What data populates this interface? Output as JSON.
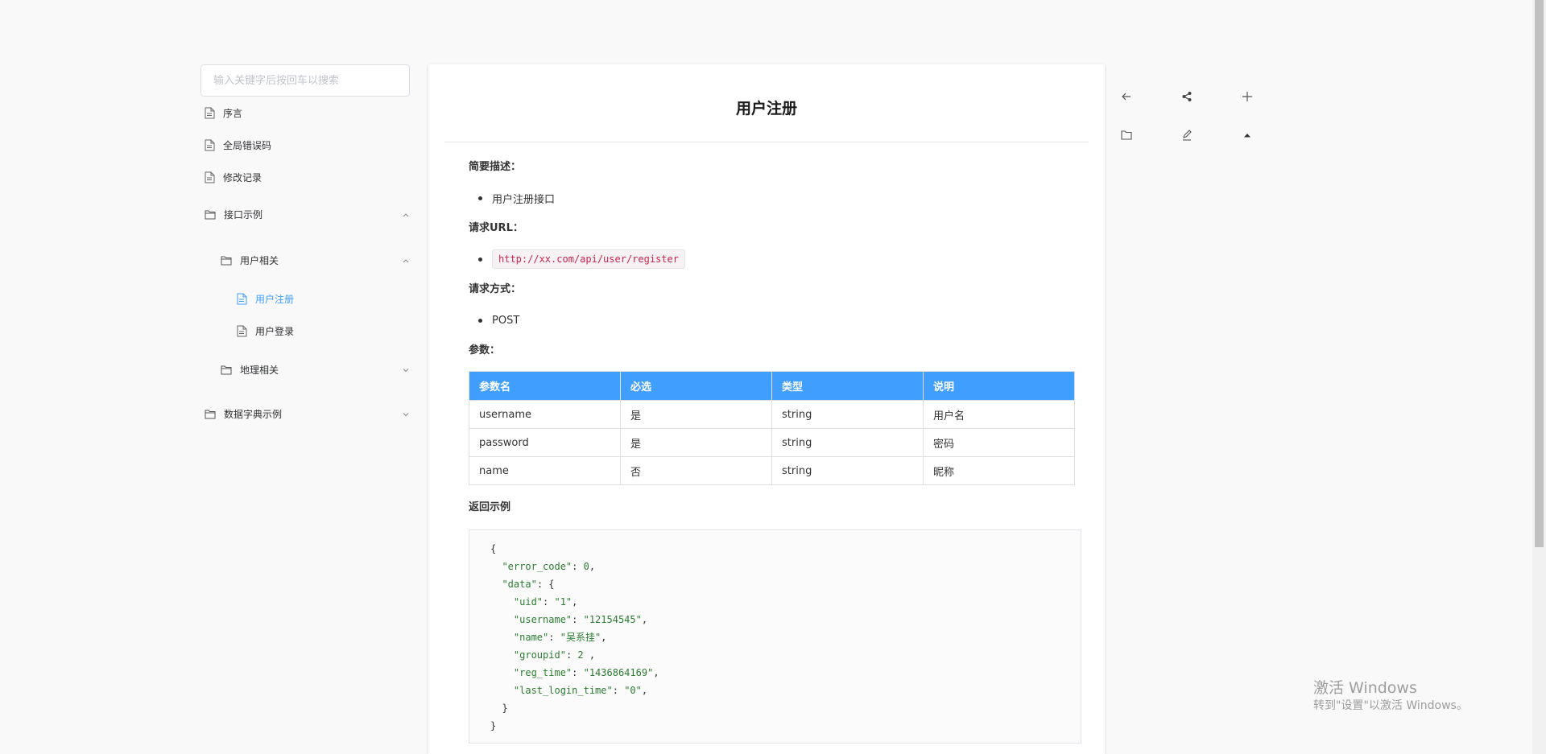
{
  "sidebar": {
    "search_placeholder": "输入关键字后按回车以搜索",
    "items": [
      {
        "label": "序言"
      },
      {
        "label": "全局错误码"
      },
      {
        "label": "修改记录"
      },
      {
        "label": "接口示例"
      },
      {
        "label": "用户相关"
      },
      {
        "label": "用户注册"
      },
      {
        "label": "用户登录"
      },
      {
        "label": "地理相关"
      },
      {
        "label": "数据字典示例"
      }
    ]
  },
  "doc": {
    "title": "用户注册",
    "desc_heading": "简要描述：",
    "desc_item": "用户注册接口",
    "url_heading": "请求URL：",
    "url_value": "http://xx.com/api/user/register",
    "method_heading": "请求方式：",
    "method_value": "POST",
    "params_heading": "参数：",
    "table": {
      "headers": [
        "参数名",
        "必选",
        "类型",
        "说明"
      ],
      "rows": [
        [
          "username",
          "是",
          "string",
          "用户名"
        ],
        [
          "password",
          "是",
          "string",
          "密码"
        ],
        [
          "name",
          "否",
          "string",
          "昵称"
        ]
      ]
    },
    "return_heading": "返回示例",
    "return_code": {
      "l1": "{",
      "l2k": "\"error_code\"",
      "l2v": "0",
      "l3k": "\"data\"",
      "l3v": "{",
      "l4k": "\"uid\"",
      "l4v": "\"1\"",
      "l5k": "\"username\"",
      "l5v": "\"12154545\"",
      "l6k": "\"name\"",
      "l6v": "\"吴系挂\"",
      "l7k": "\"groupid\"",
      "l7v": "2",
      "l8k": "\"reg_time\"",
      "l8v": "\"1436864169\"",
      "l9k": "\"last_login_time\"",
      "l9v": "\"0\"",
      "l10": "}",
      "l11": "}"
    }
  },
  "watermark": {
    "title": "激活 Windows",
    "subtitle": "转到\"设置\"以激活 Windows。"
  },
  "colors": {
    "accent": "#409eff",
    "table_header": "#409eff",
    "string_value": "#2a7d2e",
    "inline_code": "#c7254e"
  }
}
